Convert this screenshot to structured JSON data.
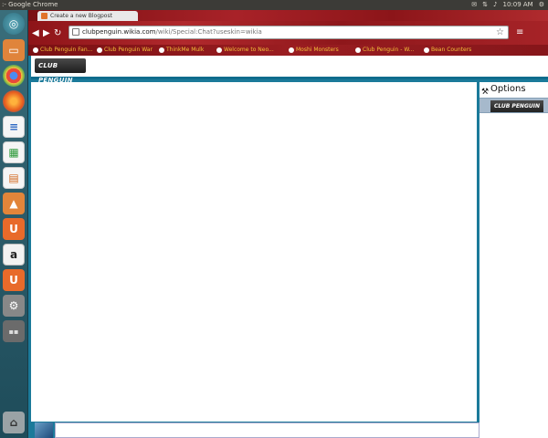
{
  "system": {
    "window_title": ":- Google Chrome",
    "clock": "10:09 AM"
  },
  "launcher": {
    "items": [
      {
        "name": "dash-home",
        "glyph": "◎"
      },
      {
        "name": "files",
        "glyph": "▭"
      },
      {
        "name": "chrome",
        "glyph": ""
      },
      {
        "name": "firefox",
        "glyph": ""
      },
      {
        "name": "writer",
        "glyph": "≡"
      },
      {
        "name": "calc",
        "glyph": "▦"
      },
      {
        "name": "impress",
        "glyph": "▤"
      },
      {
        "name": "software-center",
        "glyph": "▲"
      },
      {
        "name": "ubuntu-one",
        "glyph": "U"
      },
      {
        "name": "amazon",
        "glyph": "a"
      },
      {
        "name": "ubuntu-one-music",
        "glyph": "U"
      },
      {
        "name": "system-settings",
        "glyph": "⚙"
      },
      {
        "name": "workspace-switcher",
        "glyph": "▪▪"
      },
      {
        "name": "trash",
        "glyph": "🗑"
      }
    ]
  },
  "browser": {
    "tab_title": "Create a new Blogpost",
    "url_host": "clubpenguin.wikia.com",
    "url_path": "/wiki/Special:Chat?useskin=wikia",
    "bookmarks": [
      "Club Penguin Fan...",
      "Club Penguin War",
      "ThinkMe Mulk",
      "Welcome to Neo...",
      "Moshi Monsters",
      "Club Penguin - W...",
      "Bean Counters"
    ]
  },
  "chat": {
    "logo_text": "CLUB PENGUIN",
    "options_label": "Options",
    "user_logo_text": "CLUB PENGUIN",
    "input_value": ""
  }
}
